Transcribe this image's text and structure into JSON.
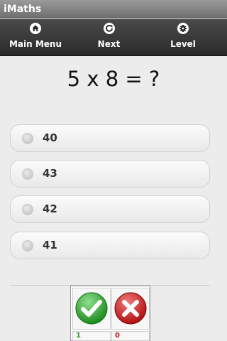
{
  "app": {
    "title": "iMaths"
  },
  "nav": {
    "items": [
      {
        "label": "Main Menu",
        "icon": "home-icon"
      },
      {
        "label": "Next",
        "icon": "refresh-icon"
      },
      {
        "label": "Level",
        "icon": "gear-icon"
      }
    ]
  },
  "question": {
    "text": "5 x 8 = ?"
  },
  "options": [
    {
      "label": "40"
    },
    {
      "label": "43"
    },
    {
      "label": "42"
    },
    {
      "label": "41"
    }
  ],
  "results": {
    "correct_icon": "check-icon",
    "wrong_icon": "cross-icon",
    "correct_count": "1",
    "wrong_count": "0",
    "correct_color": "#2a9a2a",
    "wrong_color": "#c01818"
  }
}
